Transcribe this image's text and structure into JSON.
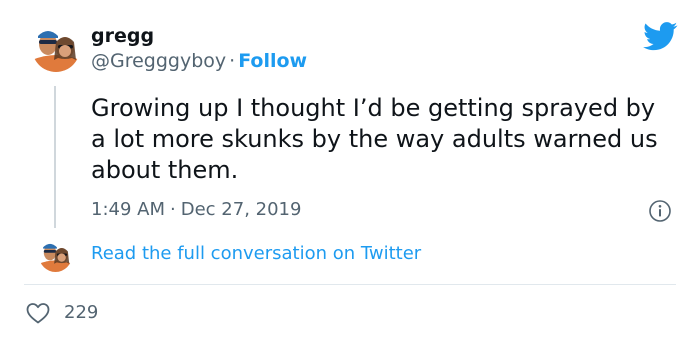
{
  "user": {
    "display_name": "gregg",
    "handle": "@Gregggyboy",
    "separator": "·",
    "follow_label": "Follow"
  },
  "tweet": {
    "text": "Growing up I thought I’d be getting sprayed by a lot more skunks by the way adults warned us about them.",
    "time": "1:49 AM",
    "separator": "·",
    "date": "Dec 27, 2019"
  },
  "conversation_link": "Read the full conversation on Twitter",
  "likes": {
    "count": "229"
  },
  "colors": {
    "brand_blue": "#1d9bf0",
    "text_primary": "#0f1419",
    "text_secondary": "#536471"
  },
  "icons": {
    "brand": "twitter-bird-icon",
    "info": "info-icon",
    "like": "heart-icon"
  }
}
